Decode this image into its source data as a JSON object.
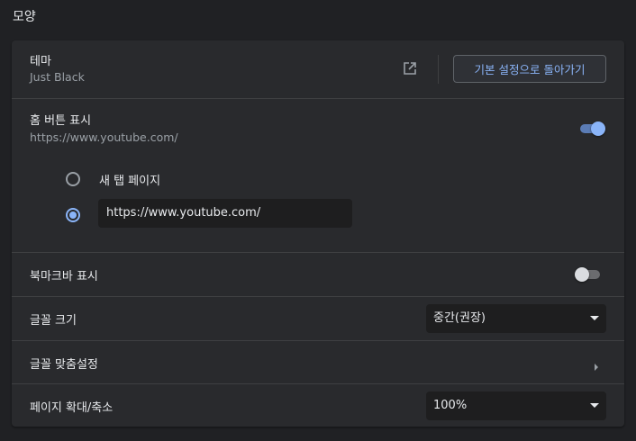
{
  "section_title": "모양",
  "theme": {
    "label": "테마",
    "value": "Just Black",
    "reset_button": "기본 설정으로 돌아가기"
  },
  "home_button": {
    "label": "홈 버튼 표시",
    "url": "https://www.youtube.com/",
    "enabled": true,
    "options": {
      "new_tab": "새 탭 페이지",
      "custom_url_value": "https://www.youtube.com/"
    }
  },
  "bookmarks_bar": {
    "label": "북마크바 표시",
    "enabled": false
  },
  "font_size": {
    "label": "글꼴 크기",
    "selected": "중간(권장)"
  },
  "customize_fonts": {
    "label": "글꼴 맞춤설정"
  },
  "page_zoom": {
    "label": "페이지 확대/축소",
    "selected": "100%"
  },
  "colors": {
    "accent": "#8ab4f8",
    "background": "#202124",
    "card": "#292a2d"
  }
}
